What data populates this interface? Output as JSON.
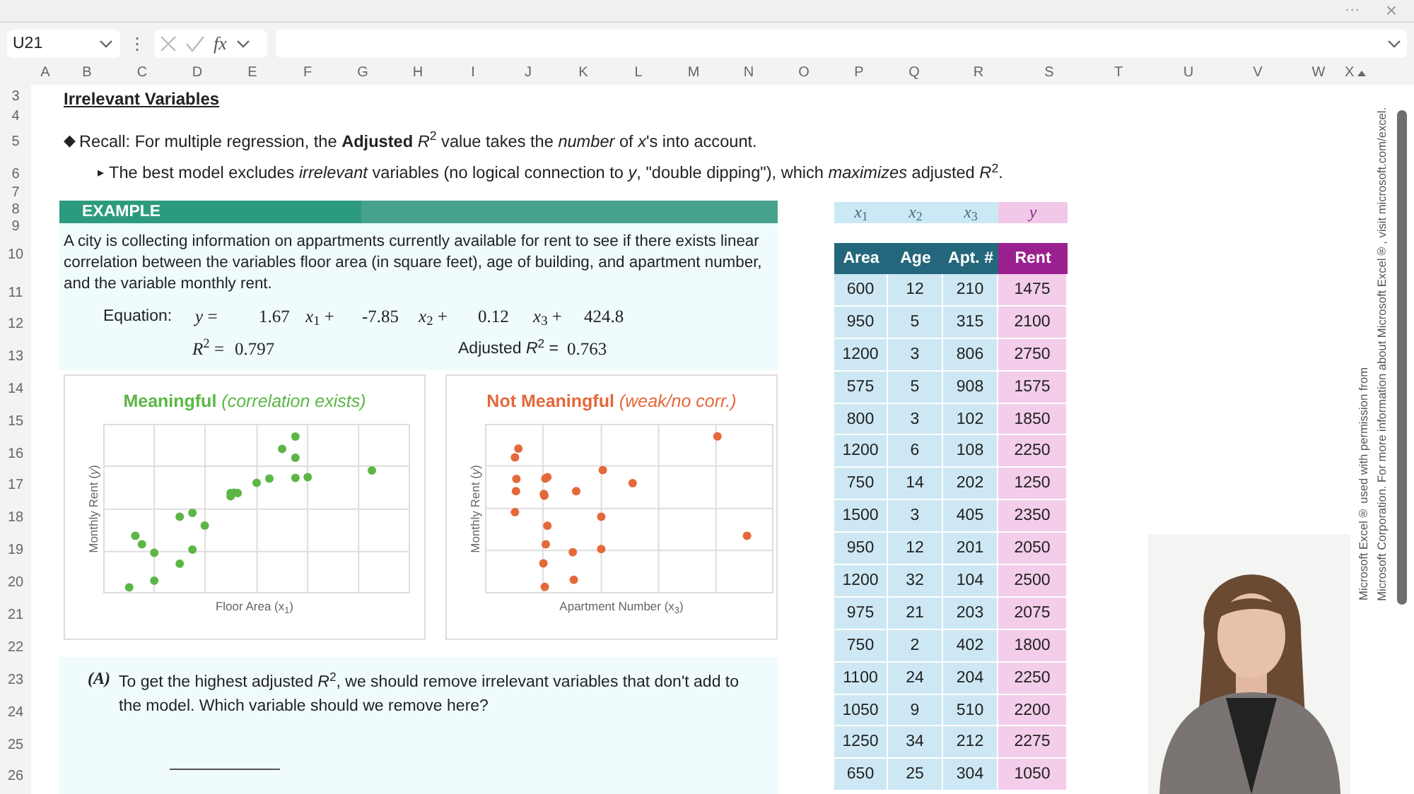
{
  "top_bar": {
    "more": "···",
    "close": "×"
  },
  "formula_bar": {
    "name_box": "U21",
    "menu": "⋮",
    "fx": "fx"
  },
  "column_headers": [
    "A",
    "B",
    "C",
    "D",
    "E",
    "F",
    "G",
    "H",
    "I",
    "J",
    "K",
    "L",
    "M",
    "N",
    "O",
    "P",
    "Q",
    "R",
    "S",
    "T",
    "U",
    "V",
    "W",
    "X"
  ],
  "row_headers": [
    "3",
    "4",
    "5",
    "6",
    "7",
    "8",
    "9",
    "10",
    "11",
    "12",
    "13",
    "14",
    "15",
    "16",
    "17",
    "18",
    "19",
    "20",
    "21",
    "22",
    "23",
    "24",
    "25",
    "26"
  ],
  "title": "Irrelevant Variables",
  "bullets": [
    {
      "marker": "◆",
      "text": "Recall: For multiple regression, the **Adjusted** *R*$^{2}$ value takes the *number* of *x*'s into account.",
      "children": [
        {
          "marker": "▸",
          "text": "The best model excludes *irrelevant* variables (no logical connection to *y*, \"double dipping\"), which *maximizes* adjusted *R*$^{2}$."
        }
      ]
    }
  ],
  "example": {
    "banner": "EXAMPLE",
    "description": "A city is collecting information on appartments currently available for rent to see if there exists linear correlation between the variables floor area (in square feet), age of building, and apartment number, and the variable monthly rent.",
    "equation_label": "Equation:",
    "equation": [
      "*y* =",
      "1.67",
      "*x*$_{1}$ +",
      "-7.85",
      "*x*$_{2}$ +",
      "0.12",
      "*x*$_{3}$ +",
      "424.8"
    ],
    "fit": [
      "*R*$^{2}$ =",
      "0.797",
      "Adjusted *R*$^{2}$ =",
      "0.763"
    ]
  },
  "charts": [
    {
      "kind": "meaningful",
      "color": "#5cb646",
      "title": "**Meaningful** *(correlation exists)*",
      "ylabel": "Monthly Rent (*y*)",
      "xlabel": "Floor Area (x$_{1}$)"
    },
    {
      "kind": "not_meaningful",
      "color": "#e4683a",
      "title": "**Not Meaningful** *(weak/no corr.)*",
      "ylabel": "Monthly Rent (*y*)",
      "xlabel": "Apartment Number (x$_{3}$)"
    }
  ],
  "question": {
    "label": "(A)",
    "text": "To get the highest adjusted *R*$^{2}$, we should remove irrelevant variables that don't add to the model. Which variable should we remove here?"
  },
  "table": {
    "variables": [
      {
        "symbol": "*x*$_{1}$",
        "kind": "x"
      },
      {
        "symbol": "*x*$_{2}$",
        "kind": "x"
      },
      {
        "symbol": "*x*$_{3}$",
        "kind": "x"
      },
      {
        "symbol": "*y*",
        "kind": "y"
      }
    ],
    "columns": [
      {
        "label": "Area",
        "kind": "x"
      },
      {
        "label": "Age",
        "kind": "x"
      },
      {
        "label": "Apt. #",
        "kind": "x"
      },
      {
        "label": "Rent",
        "kind": "y"
      }
    ],
    "rows": [
      [
        "600",
        "12",
        "210",
        "1475"
      ],
      [
        "950",
        "5",
        "315",
        "2100"
      ],
      [
        "1200",
        "3",
        "806",
        "2750"
      ],
      [
        "575",
        "5",
        "908",
        "1575"
      ],
      [
        "800",
        "3",
        "102",
        "1850"
      ],
      [
        "1200",
        "6",
        "108",
        "2250"
      ],
      [
        "750",
        "14",
        "202",
        "1250"
      ],
      [
        "1500",
        "3",
        "405",
        "2350"
      ],
      [
        "950",
        "12",
        "201",
        "2050"
      ],
      [
        "1200",
        "32",
        "104",
        "2500"
      ],
      [
        "975",
        "21",
        "203",
        "2075"
      ],
      [
        "750",
        "2",
        "402",
        "1800"
      ],
      [
        "1100",
        "24",
        "204",
        "2250"
      ],
      [
        "1050",
        "9",
        "510",
        "2200"
      ],
      [
        "1250",
        "34",
        "212",
        "2275"
      ],
      [
        "650",
        "25",
        "304",
        "1050"
      ]
    ]
  },
  "notice": [
    "Microsoft Excel® used with permission from",
    "Microsoft Corporation. For more information about Microsoft Excel®, visit microsoft.com/excel."
  ]
}
